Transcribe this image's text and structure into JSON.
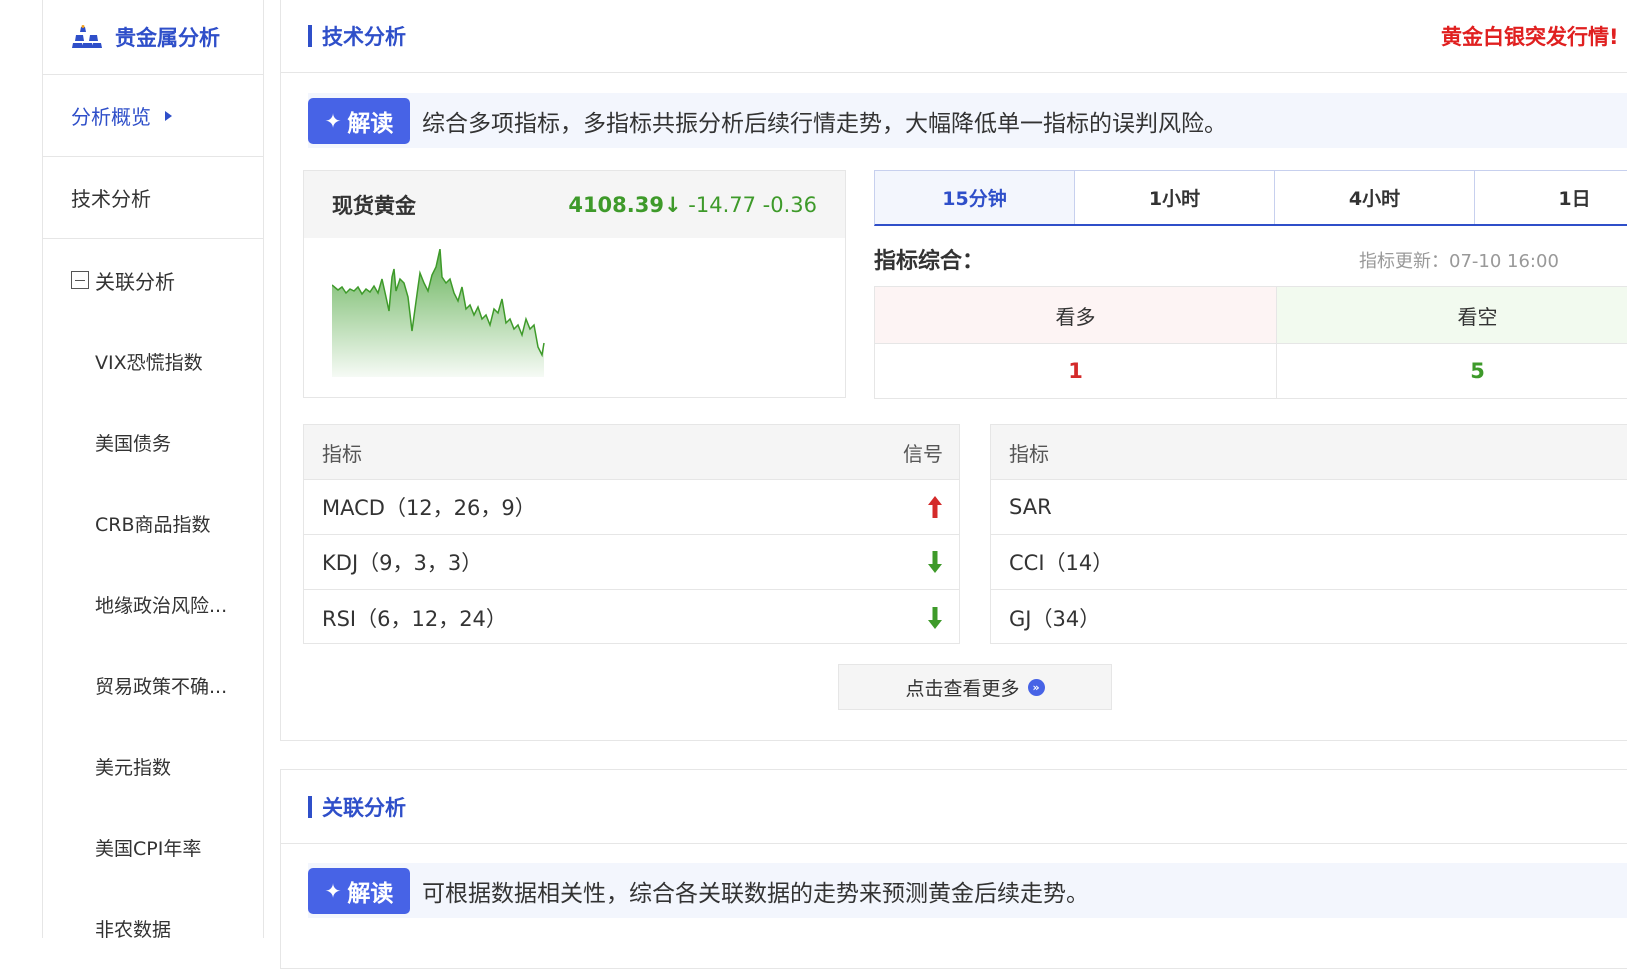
{
  "sidebar": {
    "brand": "贵金属分析",
    "items": [
      {
        "label": "分析概览"
      },
      {
        "label": "技术分析"
      },
      {
        "label": "关联分析"
      }
    ],
    "sub_items": [
      {
        "label": "VIX恐慌指数"
      },
      {
        "label": "美国债务"
      },
      {
        "label": "CRB商品指数"
      },
      {
        "label": "地缘政治风险..."
      },
      {
        "label": "贸易政策不确..."
      },
      {
        "label": "美元指数"
      },
      {
        "label": "美国CPI年率"
      },
      {
        "label": "非农数据"
      }
    ]
  },
  "tech": {
    "title": "技术分析",
    "promo": "黄金白银突发行情!",
    "interp_badge": "解读",
    "interp_text": "综合多项指标，多指标共振分析后续行情走势，大幅降低单一指标的误判风险。",
    "quote": {
      "name": "现货黄金",
      "last": "4108.39↓",
      "change": "-14.77",
      "pct": "-0.36"
    },
    "periods": [
      {
        "label": "15分钟"
      },
      {
        "label": "1小时"
      },
      {
        "label": "4小时"
      },
      {
        "label": "1日"
      }
    ],
    "summary_label": "指标综合：",
    "update_time": "指标更新：07-10 16:00",
    "vote": {
      "bull_label": "看多",
      "bull_value": "1",
      "bear_label": "看空",
      "bear_value": "5"
    },
    "left_table": {
      "col_indicator": "指标",
      "col_signal": "信号",
      "rows": [
        {
          "name": "MACD（12，26，9）",
          "signal": "up"
        },
        {
          "name": "KDJ（9，3，3）",
          "signal": "down"
        },
        {
          "name": "RSI（6，12，24）",
          "signal": "down"
        }
      ]
    },
    "right_table": {
      "col_indicator": "指标",
      "rows": [
        {
          "name": "SAR"
        },
        {
          "name": "CCI（14）"
        },
        {
          "name": "GJ（34）"
        }
      ]
    },
    "more_label": "点击查看更多"
  },
  "corr": {
    "title": "关联分析",
    "interp_badge": "解读",
    "interp_text": "可根据数据相关性，综合各关联数据的走势来预测黄金后续走势。"
  },
  "colors": {
    "accent": "#2f4fc9",
    "badge": "#4763e6",
    "bull": "#d42a2a",
    "bear": "#3e9a2a",
    "promo": "#e02020"
  }
}
